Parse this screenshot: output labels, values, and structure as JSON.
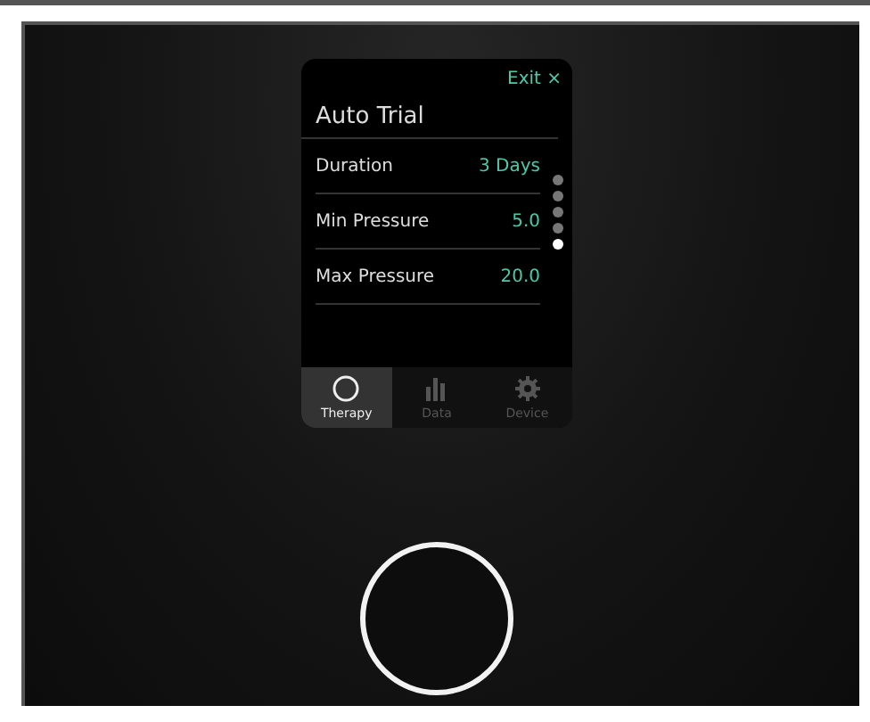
{
  "screen": {
    "exit": {
      "label": "Exit",
      "symbol": "×"
    },
    "title": "Auto Trial",
    "settings": [
      {
        "label": "Duration",
        "value": "3 Days"
      },
      {
        "label": "Min Pressure",
        "value": "5.0"
      },
      {
        "label": "Max Pressure",
        "value": "20.0"
      }
    ],
    "page_dots": [
      {
        "selected": false
      },
      {
        "selected": false
      },
      {
        "selected": false
      },
      {
        "selected": false
      },
      {
        "selected": true
      }
    ],
    "tabs": [
      {
        "label": "Therapy",
        "kind": "therapy",
        "selected": true
      },
      {
        "label": "Data",
        "kind": "data",
        "selected": false
      },
      {
        "label": "Device",
        "kind": "device",
        "selected": false
      }
    ]
  }
}
